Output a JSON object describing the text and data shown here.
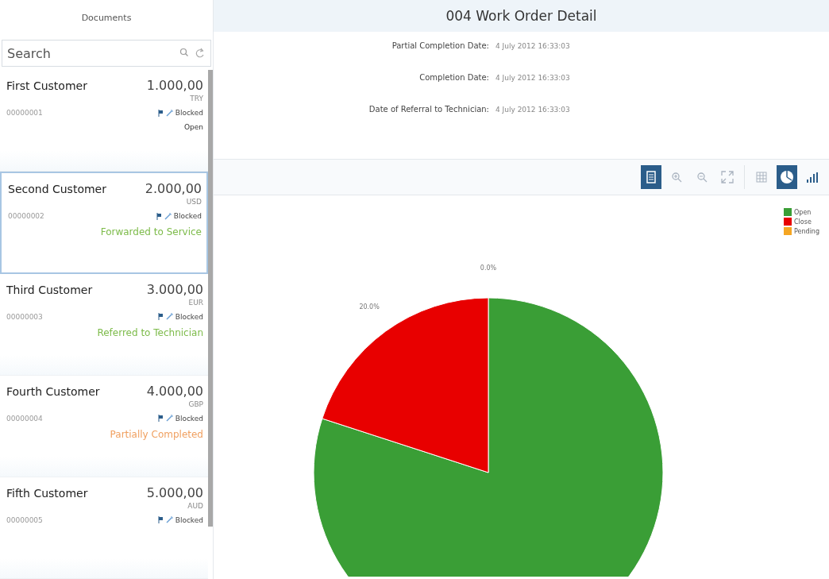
{
  "sidebar": {
    "title": "Documents",
    "search": {
      "placeholder": "Search"
    },
    "items": [
      {
        "name": "First Customer",
        "amount": "1.000,00",
        "currency": "TRY",
        "number": "00000001",
        "flag": "Blocked",
        "status": "Open",
        "selected": false
      },
      {
        "name": "Second Customer",
        "amount": "2.000,00",
        "currency": "USD",
        "number": "00000002",
        "flag": "Blocked",
        "status": "Forwarded to Service",
        "color": "#7dbb4a",
        "selected": true
      },
      {
        "name": "Third Customer",
        "amount": "3.000,00",
        "currency": "EUR",
        "number": "00000003",
        "flag": "Blocked",
        "status": "Referred to Technician",
        "color": "#7dbb4a",
        "selected": false
      },
      {
        "name": "Fourth Customer",
        "amount": "4.000,00",
        "currency": "GBP",
        "number": "00000004",
        "flag": "Blocked",
        "status": "Partially Completed",
        "color": "#f0a060",
        "selected": false
      },
      {
        "name": "Fifth Customer",
        "amount": "5.000,00",
        "currency": "AUD",
        "number": "00000005",
        "flag": "Blocked",
        "selected": false
      }
    ]
  },
  "detail": {
    "title": "004 Work Order Detail",
    "fields": [
      {
        "label": "Partial Completion Date:",
        "value": "4 July 2012 16:33:03"
      },
      {
        "label": "Completion Date:",
        "value": "4 July 2012 16:33:03"
      },
      {
        "label": "Date of Referral to Technician:",
        "value": "4 July 2012 16:33:03"
      }
    ],
    "toolbar": [
      {
        "kind": "list",
        "selected": true
      },
      {
        "kind": "zoom-in",
        "selected": false
      },
      {
        "kind": "zoom-out",
        "selected": false
      },
      {
        "kind": "fullscreen",
        "selected": false
      },
      {
        "kind": "table",
        "selected": false
      },
      {
        "kind": "pie",
        "selected": true
      },
      {
        "kind": "bar",
        "selected": false
      }
    ],
    "chart_data": {
      "type": "pie",
      "categories": [
        "Open",
        "Close",
        "Pending"
      ],
      "values": [
        80,
        20,
        0
      ],
      "colors": [
        "#3a9e36",
        "#e80000",
        "#f5a623"
      ],
      "value_labels": [
        null,
        "20.0%",
        "0.0%"
      ],
      "legend": true
    }
  }
}
